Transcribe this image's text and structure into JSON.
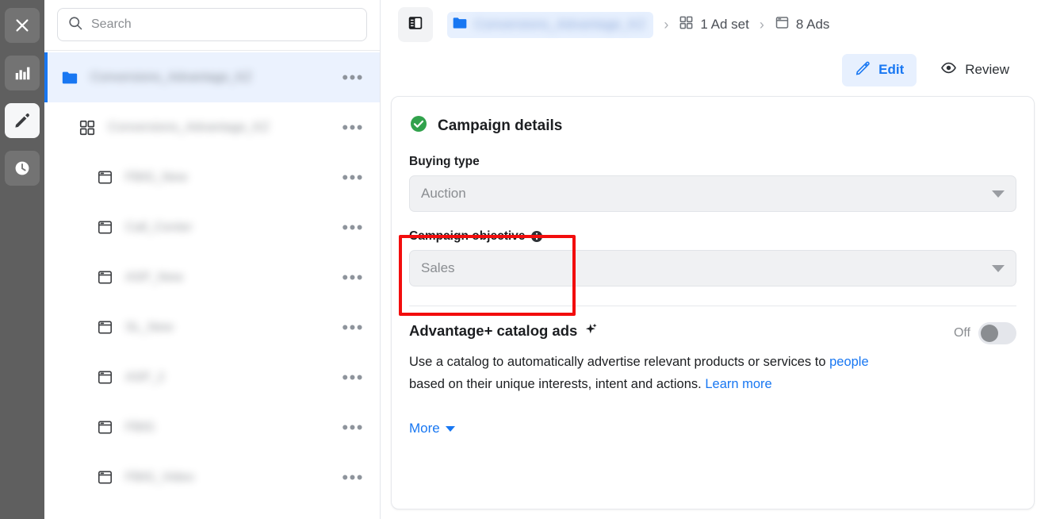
{
  "rail": {
    "items": [
      {
        "name": "close-icon",
        "label": "Close",
        "active": false
      },
      {
        "name": "analytics-icon",
        "label": "Analytics",
        "active": false
      },
      {
        "name": "edit-icon",
        "label": "Edit",
        "active": true
      },
      {
        "name": "history-icon",
        "label": "History",
        "active": false
      }
    ]
  },
  "sidebar": {
    "search": {
      "placeholder": "Search",
      "value": "",
      "icon": "search-icon"
    },
    "tree": [
      {
        "label": "Conversions_Advantage_KZ",
        "icon": "folder-icon",
        "level": 1,
        "selected": true,
        "menu": "•••"
      },
      {
        "label": "Conversions_Advantage_KZ",
        "icon": "adset-grid-icon",
        "level": 2,
        "selected": false,
        "menu": "•••"
      },
      {
        "label": "FBIG_New",
        "icon": "ad-window-icon",
        "level": 3,
        "selected": false,
        "menu": "•••"
      },
      {
        "label": "Call_Center",
        "icon": "ad-window-icon",
        "level": 3,
        "selected": false,
        "menu": "•••"
      },
      {
        "label": "ASP_New",
        "icon": "ad-window-icon",
        "level": 3,
        "selected": false,
        "menu": "•••"
      },
      {
        "label": "SL_New",
        "icon": "ad-window-icon",
        "level": 3,
        "selected": false,
        "menu": "•••"
      },
      {
        "label": "ASP_2",
        "icon": "ad-window-icon",
        "level": 3,
        "selected": false,
        "menu": "•••"
      },
      {
        "label": "FBIG",
        "icon": "ad-window-icon",
        "level": 3,
        "selected": false,
        "menu": "•••"
      },
      {
        "label": "FBIG_Video",
        "icon": "ad-window-icon",
        "level": 3,
        "selected": false,
        "menu": "•••"
      }
    ]
  },
  "topbar": {
    "panel_toggle_icon": "sidebar-toggle-icon",
    "breadcrumb": {
      "campaign": {
        "label": "Conversions_Advantage_KZ",
        "icon": "folder-icon"
      },
      "separator": "›",
      "adset": {
        "label": "1 Ad set",
        "icon": "adset-grid-icon"
      },
      "ads": {
        "label": "8 Ads",
        "icon": "ad-window-icon"
      }
    },
    "actions": {
      "edit": {
        "label": "Edit",
        "icon": "pencil-icon",
        "active": true
      },
      "review": {
        "label": "Review",
        "icon": "eye-icon",
        "active": false
      }
    }
  },
  "card": {
    "status_icon": "check-circle-icon",
    "title": "Campaign details",
    "buying_type": {
      "label": "Buying type",
      "value": "Auction",
      "caret_icon": "chevron-down-icon",
      "options": [
        "Auction"
      ]
    },
    "campaign_objective": {
      "label": "Campaign objective",
      "info_icon": "info-icon",
      "value": "Sales",
      "caret_icon": "chevron-down-icon",
      "options": [
        "Sales"
      ],
      "highlighted": true
    },
    "advantage": {
      "title": "Advantage+ catalog ads",
      "sparkle_icon": "sparkle-icon",
      "toggle_state": "Off",
      "description_part1": "Use a catalog to automatically advertise relevant products or services to ",
      "description_link": "people",
      "description_part2": " based on their unique interests, intent and actions. ",
      "learn_more": "Learn more"
    },
    "more": {
      "label": "More",
      "caret_icon": "chevron-down-icon"
    }
  },
  "colors": {
    "accent_blue": "#1877f2",
    "highlight_red": "#f20d0d",
    "success_green": "#31a24c",
    "rail_gray": "#5f5f5f",
    "selected_row_bg": "#ebf2fe"
  }
}
